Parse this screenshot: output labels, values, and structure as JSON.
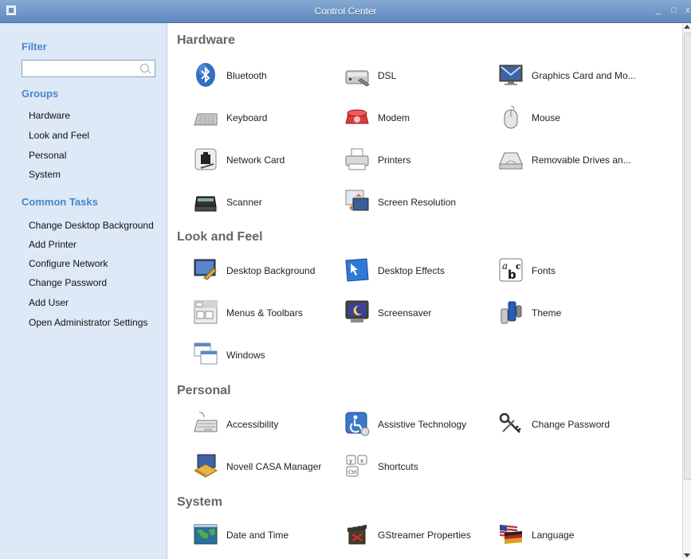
{
  "window": {
    "title": "Control Center",
    "minimize": "_",
    "maximize": "□",
    "close": "x"
  },
  "sidebar": {
    "filter_heading": "Filter",
    "filter_value": "",
    "groups_heading": "Groups",
    "groups": [
      "Hardware",
      "Look and Feel",
      "Personal",
      "System"
    ],
    "tasks_heading": "Common Tasks",
    "tasks": [
      "Change Desktop Background",
      "Add Printer",
      "Configure Network",
      "Change Password",
      "Add User",
      "Open Administrator Settings"
    ]
  },
  "sections": [
    {
      "title": "Hardware",
      "items": [
        {
          "label": "Bluetooth",
          "icon": "bluetooth-icon"
        },
        {
          "label": "DSL",
          "icon": "dsl-icon"
        },
        {
          "label": "Graphics Card and Mo...",
          "icon": "graphics-card-icon"
        },
        {
          "label": "Keyboard",
          "icon": "keyboard-icon"
        },
        {
          "label": "Modem",
          "icon": "modem-icon"
        },
        {
          "label": "Mouse",
          "icon": "mouse-icon"
        },
        {
          "label": "Network Card",
          "icon": "network-card-icon"
        },
        {
          "label": "Printers",
          "icon": "printer-icon"
        },
        {
          "label": "Removable Drives an...",
          "icon": "removable-drive-icon"
        },
        {
          "label": "Scanner",
          "icon": "scanner-icon"
        },
        {
          "label": "Screen Resolution",
          "icon": "screen-resolution-icon"
        }
      ]
    },
    {
      "title": "Look and Feel",
      "items": [
        {
          "label": "Desktop Background",
          "icon": "desktop-background-icon"
        },
        {
          "label": "Desktop Effects",
          "icon": "desktop-effects-icon"
        },
        {
          "label": "Fonts",
          "icon": "fonts-icon"
        },
        {
          "label": "Menus & Toolbars",
          "icon": "menus-toolbars-icon"
        },
        {
          "label": "Screensaver",
          "icon": "screensaver-icon"
        },
        {
          "label": "Theme",
          "icon": "theme-icon"
        },
        {
          "label": "Windows",
          "icon": "windows-icon"
        }
      ]
    },
    {
      "title": "Personal",
      "items": [
        {
          "label": "Accessibility",
          "icon": "accessibility-icon"
        },
        {
          "label": "Assistive Technology",
          "icon": "assistive-technology-icon"
        },
        {
          "label": "Change Password",
          "icon": "keys-icon"
        },
        {
          "label": "Novell CASA Manager",
          "icon": "casa-manager-icon"
        },
        {
          "label": "Shortcuts",
          "icon": "shortcuts-icon"
        }
      ]
    },
    {
      "title": "System",
      "items": [
        {
          "label": "Date and Time",
          "icon": "date-time-icon"
        },
        {
          "label": "GStreamer Properties",
          "icon": "gstreamer-icon"
        },
        {
          "label": "Language",
          "icon": "language-icon"
        }
      ]
    }
  ],
  "colors": {
    "sidebar_bg": "#dde9f7",
    "heading_blue": "#4b84c7",
    "section_heading": "#666666"
  }
}
